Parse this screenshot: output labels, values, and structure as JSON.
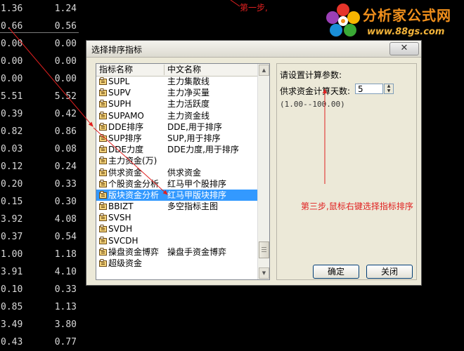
{
  "background_table": {
    "rows": [
      [
        "1.36",
        "1.24"
      ],
      [
        "0.66",
        "0.56"
      ],
      [
        "0.00",
        "0.00"
      ],
      [
        "0.00",
        "0.00"
      ],
      [
        "0.00",
        "0.00"
      ],
      [
        "5.51",
        "5.52"
      ],
      [
        "0.39",
        "0.42"
      ],
      [
        "0.82",
        "0.86"
      ],
      [
        "0.03",
        "0.08"
      ],
      [
        "0.12",
        "0.24"
      ],
      [
        "0.20",
        "0.33"
      ],
      [
        "0.15",
        "0.30"
      ],
      [
        "3.92",
        "4.08"
      ],
      [
        "0.37",
        "0.54"
      ],
      [
        "1.00",
        "1.18"
      ],
      [
        "3.91",
        "4.10"
      ],
      [
        "0.10",
        "0.33"
      ],
      [
        "0.85",
        "1.13"
      ],
      [
        "3.49",
        "3.80"
      ],
      [
        "0.43",
        "0.77"
      ]
    ]
  },
  "annotations": {
    "step1": "第一步,",
    "step3": "第三步,鼠标右键选择指标排序"
  },
  "logo": {
    "title": "分析家公式网",
    "url": "www.88gs.com"
  },
  "dialog": {
    "title": "选择排序指标",
    "close_symbol": "✕",
    "list": {
      "col_name": "指标名称",
      "col_cn": "中文名称",
      "items": [
        {
          "name": "SUPL",
          "cn": "主力集散线"
        },
        {
          "name": "SUPV",
          "cn": "主力净买量"
        },
        {
          "name": "SUPH",
          "cn": "主力活跃度"
        },
        {
          "name": "SUPAMO",
          "cn": "主力资金线"
        },
        {
          "name": "DDE排序",
          "cn": "DDE,用于排序"
        },
        {
          "name": "SUP排序",
          "cn": "SUP,用于排序"
        },
        {
          "name": "DDE力度",
          "cn": "DDE力度,用于排序"
        },
        {
          "name": "主力资金(万)",
          "cn": ""
        },
        {
          "name": "供求资金",
          "cn": "供求资金"
        },
        {
          "name": "个股资金分析",
          "cn": "红马甲个股排序"
        },
        {
          "name": "版块资金分析",
          "cn": "红马甲版块排序"
        },
        {
          "name": "BBIZT",
          "cn": "多空指标主图"
        },
        {
          "name": "SVSH",
          "cn": ""
        },
        {
          "name": "SVDH",
          "cn": ""
        },
        {
          "name": "SVCDH",
          "cn": ""
        },
        {
          "name": "操盘资金博弈",
          "cn": "操盘手资金博弈"
        },
        {
          "name": "超级资金",
          "cn": ""
        }
      ],
      "selected_index": 10
    },
    "params": {
      "title": "请设置计算参数:",
      "label": "供求资金计算天数:",
      "value": "5",
      "range": "(1.00--100.00)"
    },
    "ok_label": "确定",
    "close_label": "关闭"
  },
  "colors": {
    "annotation_red": "#e02020",
    "selection_blue": "#3399ff",
    "logo_orange": "#f08f1c"
  }
}
